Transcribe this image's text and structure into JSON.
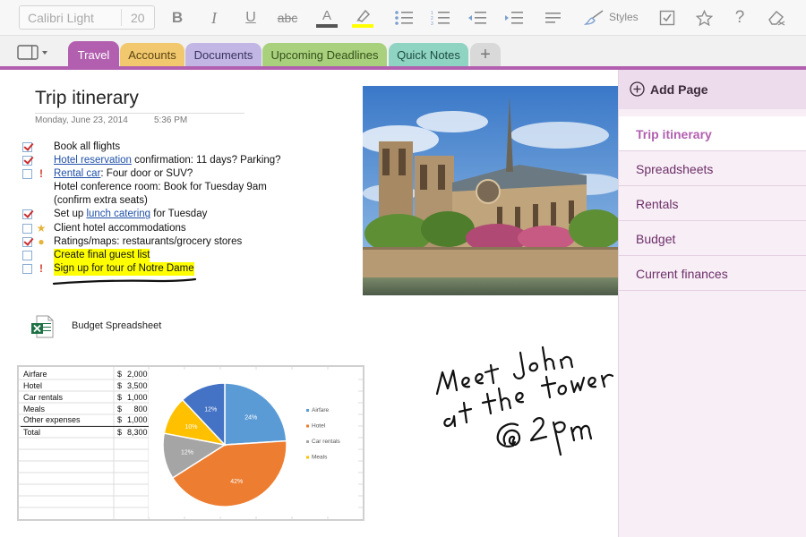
{
  "toolbar": {
    "font_name": "Calibri Light",
    "font_size": "20",
    "styles_label": "Styles",
    "buttons": [
      "bold",
      "italic",
      "underline",
      "strikethrough",
      "font-color",
      "highlight",
      "bullets",
      "numbering",
      "outdent",
      "indent",
      "align",
      "styles",
      "tag",
      "favorite",
      "help",
      "clear-format"
    ],
    "bold_label": "B",
    "italic_label": "I",
    "underline_label": "U",
    "strike_label": "abc",
    "font_color_label": "A",
    "help_label": "?"
  },
  "tabs": [
    {
      "label": "Travel",
      "color": "#b25fb0",
      "active": true
    },
    {
      "label": "Accounts",
      "color": "#f2c86e"
    },
    {
      "label": "Documents",
      "color": "#c2b6e4"
    },
    {
      "label": "Upcoming Deadlines",
      "color": "#a9d17d"
    },
    {
      "label": "Quick Notes",
      "color": "#8fd3c3"
    }
  ],
  "tab_add_label": "+",
  "page": {
    "title": "Trip itinerary",
    "date": "Monday, June 23, 2014",
    "time": "5:36 PM"
  },
  "todo": [
    {
      "checked": true,
      "flag": "",
      "pre": "Book all flights",
      "link": "",
      "post": "",
      "highlight": false
    },
    {
      "checked": true,
      "flag": "",
      "pre": "",
      "link": "Hotel reservation",
      "post": " confirmation: 11 days? Parking?",
      "highlight": false
    },
    {
      "checked": false,
      "flag": "important",
      "pre": "",
      "link": "Rental car",
      "post": ": Four door or SUV?",
      "highlight": false
    },
    {
      "checked": null,
      "flag": "",
      "pre": "Hotel conference room: Book for Tuesday 9am",
      "link": "",
      "post": "",
      "highlight": false
    },
    {
      "checked": null,
      "flag": "",
      "pre": "(confirm extra seats)",
      "link": "",
      "post": "",
      "highlight": false
    },
    {
      "checked": true,
      "flag": "",
      "pre": "Set up ",
      "link": "lunch catering",
      "post": " for Tuesday",
      "highlight": false
    },
    {
      "checked": false,
      "flag": "star",
      "pre": "Client hotel accommodations",
      "link": "",
      "post": "",
      "highlight": false
    },
    {
      "checked": true,
      "flag": "idea",
      "pre": "Ratings/maps: restaurants/grocery stores",
      "link": "",
      "post": "",
      "highlight": false
    },
    {
      "checked": false,
      "flag": "",
      "pre": "Create final guest list",
      "link": "",
      "post": "",
      "highlight": true
    },
    {
      "checked": false,
      "flag": "important",
      "pre": "Sign up for tour of Notre Dame",
      "link": "",
      "post": "",
      "highlight": true
    }
  ],
  "attachment": {
    "label": "Budget Spreadsheet",
    "icon": "excel-file-icon"
  },
  "spreadsheet": {
    "rows": [
      {
        "label": "Airfare",
        "currency": "$",
        "value": "2,000"
      },
      {
        "label": "Hotel",
        "currency": "$",
        "value": "3,500"
      },
      {
        "label": "Car rentals",
        "currency": "$",
        "value": "1,000"
      },
      {
        "label": "Meals",
        "currency": "$",
        "value": "800"
      },
      {
        "label": "Other expenses",
        "currency": "$",
        "value": "1,000"
      }
    ],
    "total": {
      "label": "Total",
      "currency": "$",
      "value": "8,300"
    }
  },
  "chart_data": {
    "type": "pie",
    "slices": [
      {
        "label": "Airfare",
        "percent": 24,
        "color": "#5b9bd5"
      },
      {
        "label": "Hotel",
        "percent": 42,
        "color": "#ed7d31"
      },
      {
        "label": "Car rentals",
        "percent": 12,
        "color": "#a5a5a5"
      },
      {
        "label": "Meals",
        "percent": 10,
        "color": "#ffc000"
      },
      {
        "label": "",
        "percent": 12,
        "color": "#4472c4"
      }
    ],
    "slice_labels": [
      "24%",
      "42%",
      "12%",
      "10%",
      "12%"
    ],
    "legend": [
      "Airfare",
      "Hotel",
      "Car rentals",
      "Meals"
    ],
    "legend_position": "right"
  },
  "handwriting": {
    "lines": [
      "Meet John",
      "at the tower",
      "@ 2pm"
    ]
  },
  "sidebar": {
    "add_label": "Add Page",
    "pages": [
      {
        "label": "Trip itinerary",
        "active": true
      },
      {
        "label": "Spreadsheets"
      },
      {
        "label": "Rentals"
      },
      {
        "label": "Budget"
      },
      {
        "label": "Current finances"
      }
    ]
  },
  "colors": {
    "accent": "#b25fb0",
    "link": "#1f4fa8",
    "highlight": "#ffff00"
  }
}
